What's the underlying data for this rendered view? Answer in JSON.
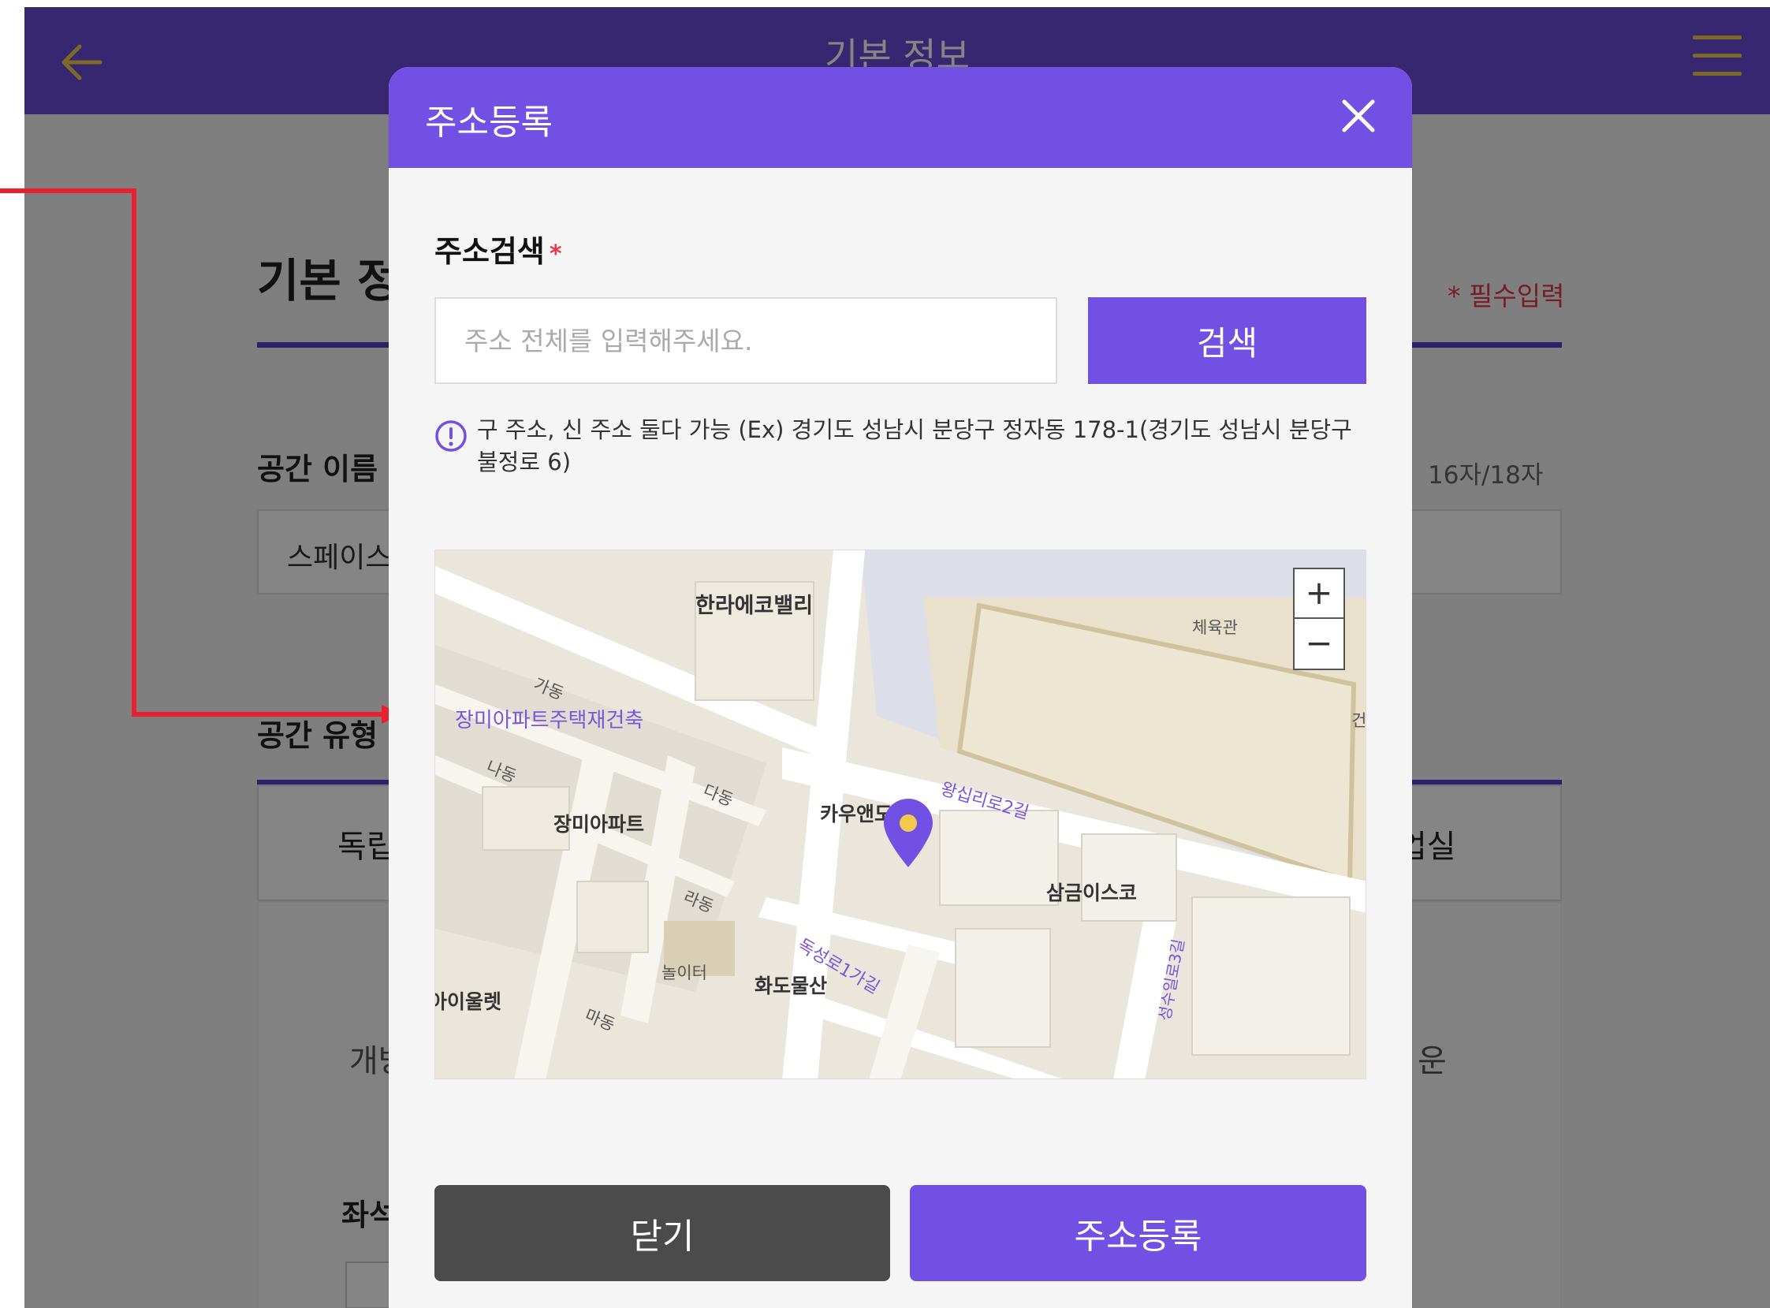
{
  "page": {
    "title": "기본 정보",
    "section_title": "기본 정보",
    "required_note": "* 필수입력",
    "space_name": {
      "label": "공간 이름",
      "value": "스페이스",
      "counter": "16자/18자"
    },
    "space_type": {
      "label": "공간 유형",
      "tab_left": "독립",
      "tab_right": "업실"
    },
    "panel": {
      "text_left": "개방",
      "text_right": "운",
      "seat_label": "좌석"
    }
  },
  "modal": {
    "title": "주소등록",
    "search": {
      "label": "주소검색",
      "required_mark": "*",
      "placeholder": "주소 전체를 입력해주세요.",
      "button_label": "검색",
      "hint": "구 주소, 신 주소 둘다 가능 (Ex) 경기도 성남시 분당구 정자동 178-1(경기도 성남시 분당구 불정로 6)"
    },
    "map": {
      "labels": [
        "한라에코밸리",
        "체육관",
        "가동",
        "장미아파트주택재건축",
        "나동",
        "다동",
        "장미아파트",
        "카우앤도",
        "왕십리로2길",
        "삼금이스코",
        "라동",
        "놀이터",
        "화도물산",
        "독성로1가길",
        "아이울렛",
        "마동",
        "성수일로3길",
        "건"
      ],
      "zoom_in": "+",
      "zoom_out": "−",
      "pin_color": "#7350e4"
    },
    "buttons": {
      "close": "닫기",
      "register": "주소등록"
    }
  },
  "colors": {
    "primary": "#7350e4",
    "header": "#6a4bd8",
    "required": "#e5384b",
    "close_button": "#4b4b4b"
  }
}
